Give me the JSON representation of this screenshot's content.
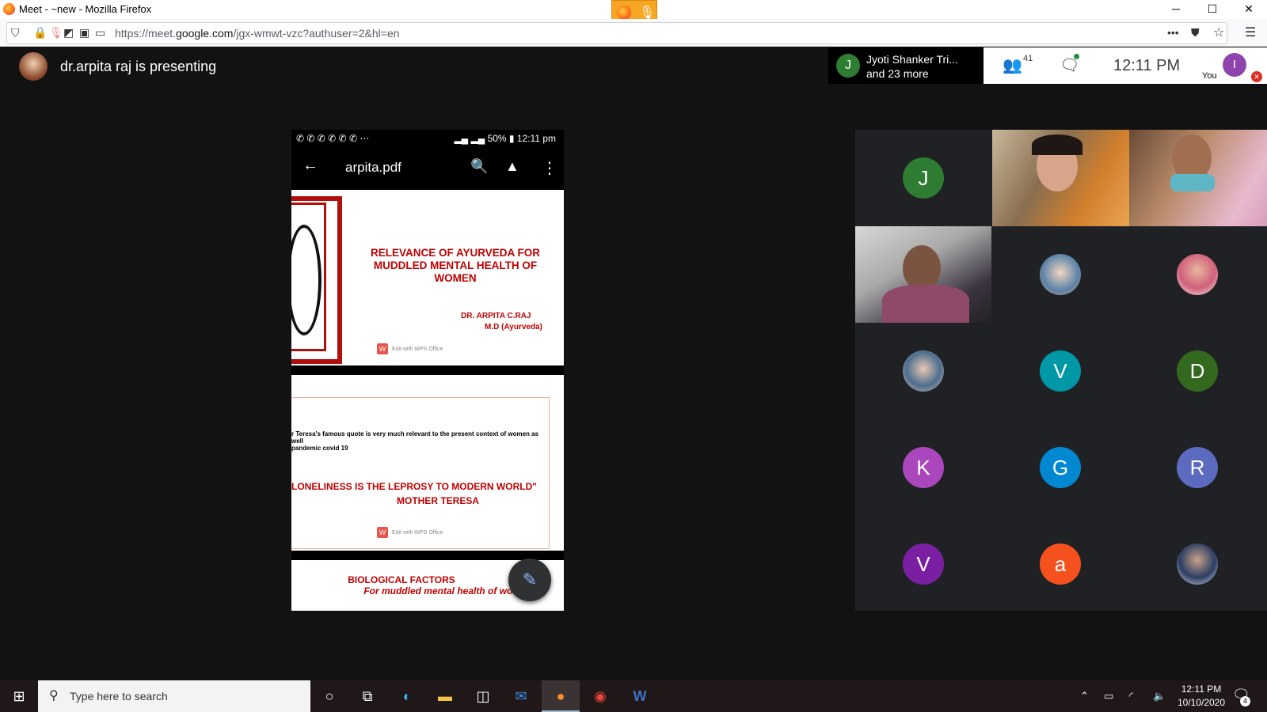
{
  "window": {
    "title": "Meet - ~new - Mozilla Firefox",
    "minimize": "─",
    "maximize": "☐",
    "close": "✕"
  },
  "browser": {
    "url_prefix": "https://meet.",
    "url_domain": "google.com",
    "url_suffix": "/jgx-wmwt-vzc?authuser=2&hl=en"
  },
  "meet": {
    "presenting_text": "dr.arpita raj is presenting",
    "joiner_initial": "J",
    "joiner_name": "Jyoti Shanker Tri...",
    "joiner_more": "and 23 more",
    "people_count": "41",
    "time": "12:11  PM",
    "you_label": "You",
    "you_initial": "I"
  },
  "phone": {
    "status_icons": "✆ ✆ ✆ ✆ ✆ ✆ ⋯",
    "status_right": "▂▄ ▂▄ 50% ▮ 12:11 pm",
    "file_name": "arpita.pdf",
    "fab_icon": "✎"
  },
  "slides": {
    "s1_title_1": "RELEVANCE OF AYURVEDA FOR",
    "s1_title_2": "MUDDLED MENTAL HEALTH OF",
    "s1_title_3": "WOMEN",
    "s1_author": "DR. ARPITA C.RAJ",
    "s1_degree": "M.D (Ayurveda)",
    "wps_text": "Edit with WPS Office",
    "s2_quote_1": "r Teresa's famous quote is very much relevant to the  present context of women as well",
    "s2_quote_2": "pandemic covid 19",
    "s2_main": "LONELINESS IS THE LEPROSY TO MODERN WORLD\"",
    "s2_who": "MOTHER TERESA",
    "s3_title": "BIOLOGICAL FACTORS",
    "s3_sub": "For muddled mental health of women"
  },
  "participants": [
    {
      "initial": "J",
      "color": "#2e7d32"
    },
    {
      "initial": "V",
      "color": "#0097a7"
    },
    {
      "initial": "D",
      "color": "#33691e"
    },
    {
      "initial": "K",
      "color": "#ab47bc"
    },
    {
      "initial": "G",
      "color": "#0288d1"
    },
    {
      "initial": "R",
      "color": "#5c6bc0"
    },
    {
      "initial": "V",
      "color": "#7b1fa2"
    },
    {
      "initial": "a",
      "color": "#f4511e"
    }
  ],
  "taskbar": {
    "search_placeholder": "Type here to search",
    "clock_time": "12:11 PM",
    "clock_date": "10/10/2020",
    "notif_count": "4"
  }
}
